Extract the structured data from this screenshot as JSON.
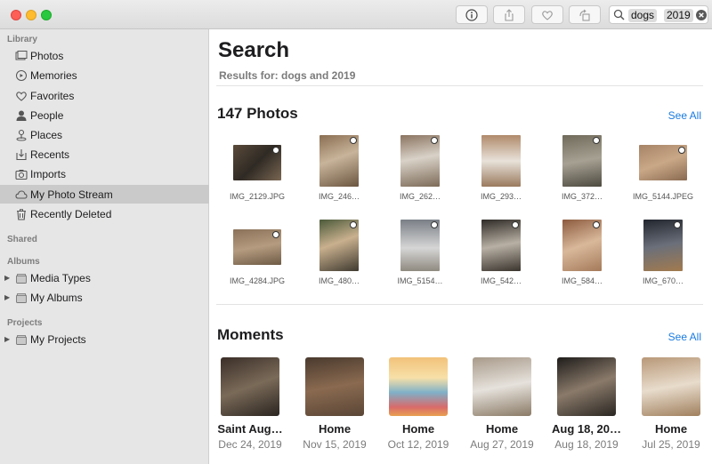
{
  "toolbar": {
    "info_icon": "info-icon",
    "share_icon": "share-icon",
    "favorite_icon": "heart-icon",
    "rotate_icon": "rotate-icon"
  },
  "search": {
    "tokens": [
      "dogs",
      "2019"
    ]
  },
  "sidebar": {
    "library_header": "Library",
    "library_items": [
      {
        "label": "Photos",
        "icon": "photos-icon"
      },
      {
        "label": "Memories",
        "icon": "memories-icon"
      },
      {
        "label": "Favorites",
        "icon": "heart-icon"
      },
      {
        "label": "People",
        "icon": "person-icon"
      },
      {
        "label": "Places",
        "icon": "pin-icon"
      },
      {
        "label": "Recents",
        "icon": "recents-icon"
      },
      {
        "label": "Imports",
        "icon": "camera-icon"
      },
      {
        "label": "My Photo Stream",
        "icon": "cloud-icon"
      },
      {
        "label": "Recently Deleted",
        "icon": "trash-icon"
      }
    ],
    "shared_header": "Shared",
    "albums_header": "Albums",
    "album_items": [
      {
        "label": "Media Types",
        "icon": "folder-icon"
      },
      {
        "label": "My Albums",
        "icon": "folder-icon"
      }
    ],
    "projects_header": "Projects",
    "project_items": [
      {
        "label": "My Projects",
        "icon": "folder-icon"
      }
    ],
    "selected": "My Photo Stream"
  },
  "main": {
    "title": "Search",
    "results_for": "Results for: dogs and 2019",
    "photos_title": "147 Photos",
    "photos_see_all": "See All",
    "photos": [
      "IMG_2129.JPG",
      "IMG_246…",
      "IMG_262…",
      "IMG_293…",
      "IMG_372…",
      "IMG_5144.JPEG",
      "IMG_4284.JPG",
      "IMG_480…",
      "IMG_5154…",
      "IMG_542…",
      "IMG_584…",
      "IMG_670…"
    ],
    "moments_title": "Moments",
    "moments_see_all": "See All",
    "moments": [
      {
        "title": "Saint Aug…",
        "date": "Dec 24, 2019"
      },
      {
        "title": "Home",
        "date": "Nov 15, 2019"
      },
      {
        "title": "Home",
        "date": "Oct 12, 2019"
      },
      {
        "title": "Home",
        "date": "Aug 27, 2019"
      },
      {
        "title": "Aug 18, 20…",
        "date": "Aug 18, 2019"
      },
      {
        "title": "Home",
        "date": "Jul 25, 2019"
      }
    ]
  }
}
